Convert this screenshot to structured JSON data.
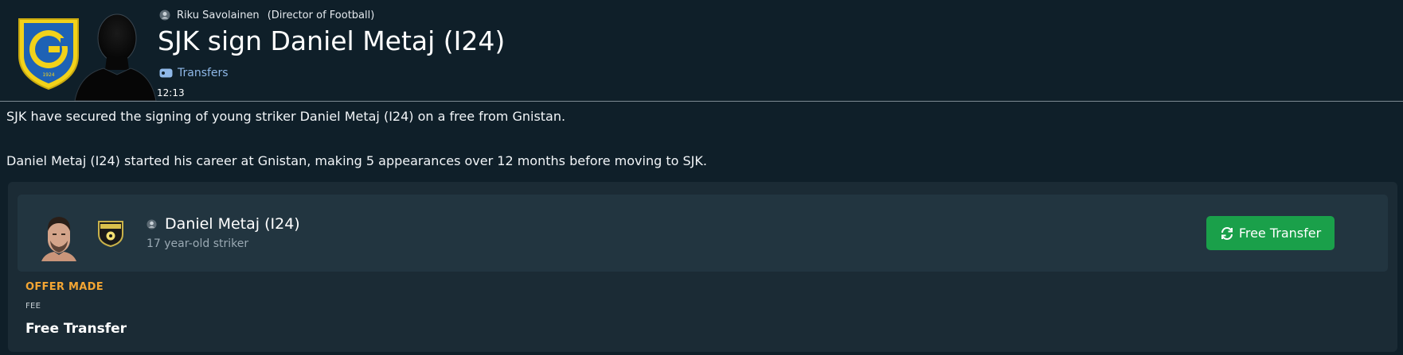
{
  "header": {
    "author_name": "Riku Savolainen",
    "author_role": "(Director of Football)",
    "headline": "SJK sign Daniel Metaj (I24)",
    "category": "Transfers",
    "time": "12:13",
    "badge_year": "1924",
    "badge_letter": "G"
  },
  "article": {
    "paragraph_1": "SJK have secured the signing of young striker Daniel Metaj (I24) on a free from Gnistan.",
    "paragraph_2": "Daniel Metaj (I24) started his career at Gnistan, making 5 appearances over 12 months before moving to SJK."
  },
  "player_card": {
    "name": "Daniel Metaj (I24)",
    "description": "17 year-old striker",
    "button_label": "Free Transfer"
  },
  "offer": {
    "status": "OFFER MADE",
    "fee_label": "FEE",
    "fee_value": "Free Transfer"
  },
  "icons": {
    "author": "person-icon",
    "category": "tag-icon",
    "button": "refresh-icon"
  },
  "colors": {
    "background": "#0f1f29",
    "card": "#1b2b35",
    "panel": "#223540",
    "accent_green": "#1aa04a",
    "offer_orange": "#f3a533",
    "link_blue": "#8fb8e8"
  }
}
